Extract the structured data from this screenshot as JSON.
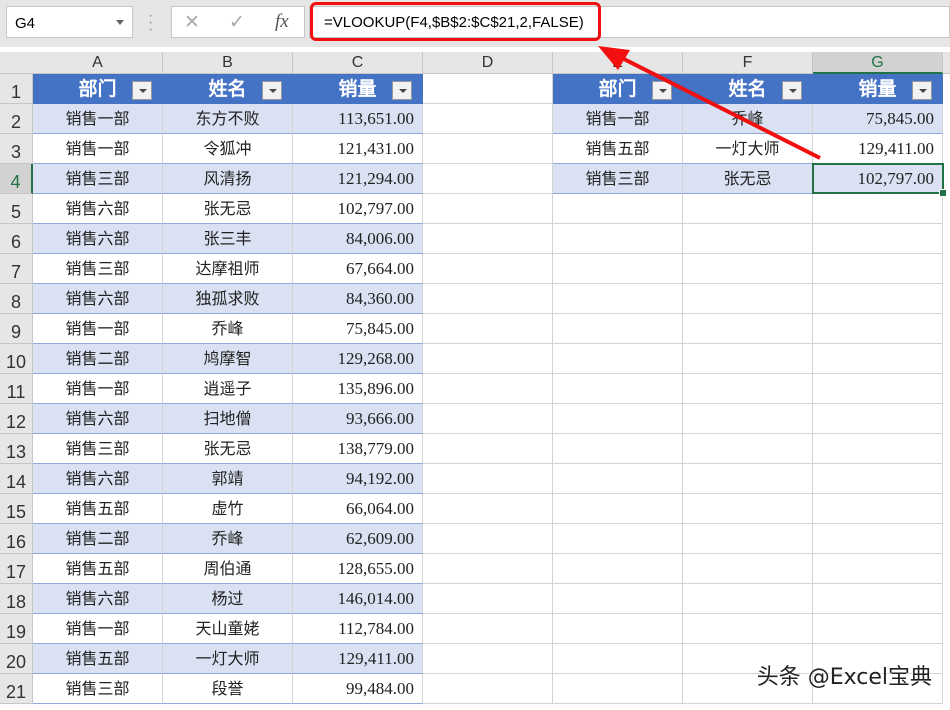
{
  "formula_bar": {
    "name_box": "G4",
    "cancel": "✕",
    "enter": "✓",
    "fx": "fx",
    "formula": "=VLOOKUP(F4,$B$2:$C$21,2,FALSE)"
  },
  "columns": [
    "A",
    "B",
    "C",
    "D",
    "E",
    "F",
    "G"
  ],
  "selected_column": "G",
  "selected_row": 4,
  "table1": {
    "headers": [
      "部门",
      "姓名",
      "销量"
    ],
    "rows": [
      [
        "销售一部",
        "东方不败",
        "113,651.00"
      ],
      [
        "销售一部",
        "令狐冲",
        "121,431.00"
      ],
      [
        "销售三部",
        "风清扬",
        "121,294.00"
      ],
      [
        "销售六部",
        "张无忌",
        "102,797.00"
      ],
      [
        "销售六部",
        "张三丰",
        "84,006.00"
      ],
      [
        "销售三部",
        "达摩祖师",
        "67,664.00"
      ],
      [
        "销售六部",
        "独孤求败",
        "84,360.00"
      ],
      [
        "销售一部",
        "乔峰",
        "75,845.00"
      ],
      [
        "销售二部",
        "鸠摩智",
        "129,268.00"
      ],
      [
        "销售一部",
        "逍遥子",
        "135,896.00"
      ],
      [
        "销售六部",
        "扫地僧",
        "93,666.00"
      ],
      [
        "销售三部",
        "张无忌",
        "138,779.00"
      ],
      [
        "销售六部",
        "郭靖",
        "94,192.00"
      ],
      [
        "销售五部",
        "虚竹",
        "66,064.00"
      ],
      [
        "销售二部",
        "乔峰",
        "62,609.00"
      ],
      [
        "销售五部",
        "周伯通",
        "128,655.00"
      ],
      [
        "销售六部",
        "杨过",
        "146,014.00"
      ],
      [
        "销售一部",
        "天山童姥",
        "112,784.00"
      ],
      [
        "销售五部",
        "一灯大师",
        "129,411.00"
      ],
      [
        "销售三部",
        "段誉",
        "99,484.00"
      ]
    ]
  },
  "table2": {
    "headers": [
      "部门",
      "姓名",
      "销量"
    ],
    "rows": [
      [
        "销售一部",
        "乔峰",
        "75,845.00"
      ],
      [
        "销售五部",
        "一灯大师",
        "129,411.00"
      ],
      [
        "销售三部",
        "张无忌",
        "102,797.00"
      ]
    ]
  },
  "watermark": "头条 @Excel宝典",
  "colors": {
    "header": "#4472c4",
    "band": "#d9e1f2",
    "highlight": "#f20f0f",
    "select": "#217346"
  }
}
